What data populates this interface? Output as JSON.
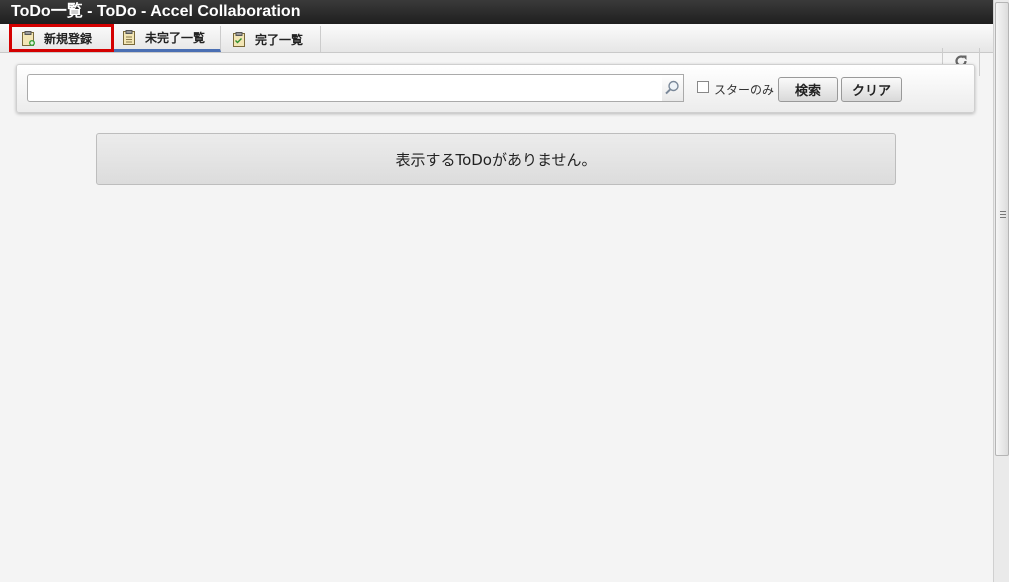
{
  "window": {
    "title": "ToDo一覧 - ToDo - Accel Collaboration"
  },
  "tabs": {
    "new_label": "新規登録",
    "unfinished_label": "未完了一覧",
    "done_label": "完了一覧"
  },
  "search": {
    "value": "",
    "star_only_label": "スターのみ",
    "search_button_label": "検索",
    "clear_button_label": "クリア"
  },
  "main": {
    "empty_message": "表示するToDoがありません。"
  },
  "colors": {
    "highlight": "#d40000",
    "active_tab_underline": "#4a6fb3"
  }
}
